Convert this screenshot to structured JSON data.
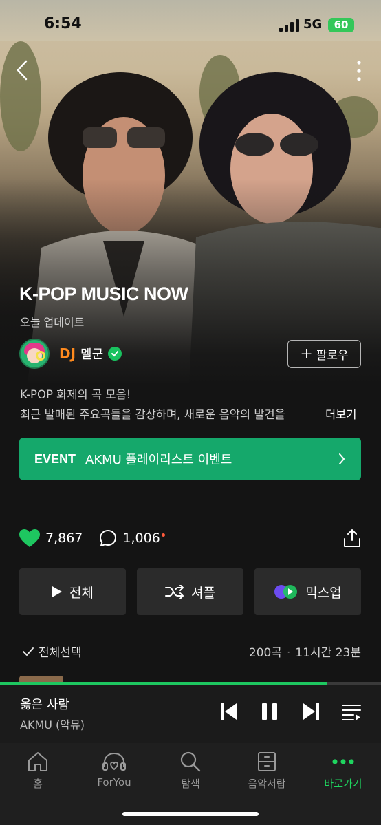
{
  "status_bar": {
    "time": "6:54",
    "network": "5G",
    "battery": "60"
  },
  "playlist": {
    "title": "K-POP MUSIC NOW",
    "subtitle": "오늘 업데이트",
    "dj_label": "DJ",
    "dj_name": "멜군",
    "follow_label": "팔로우",
    "description_line1": "K-POP 화제의 곡 모음!",
    "description_line2": "최근 발매된 주요곡들을 감상하며, 새로운 음악의 발견을",
    "more_label": "더보기"
  },
  "event": {
    "tag": "EVENT",
    "text": "AKMU 플레이리스트 이벤트"
  },
  "stats": {
    "likes": "7,867",
    "comments": "1,006"
  },
  "actions": {
    "play_all": "전체",
    "shuffle": "셔플",
    "mixup": "믹스업"
  },
  "list_header": {
    "select_all": "전체선택",
    "track_count": "200곡",
    "duration": "11시간 23분"
  },
  "now_playing": {
    "title": "옳은 사람",
    "artist": "AKMU (악뮤)",
    "progress": 0.86
  },
  "tabs": [
    {
      "label": "홈",
      "icon": "home-icon"
    },
    {
      "label": "ForYou",
      "icon": "headphones-heart-icon"
    },
    {
      "label": "탐색",
      "icon": "search-icon"
    },
    {
      "label": "음악서랍",
      "icon": "drawer-icon"
    },
    {
      "label": "바로가기",
      "icon": "more-dots-icon",
      "active": true
    }
  ],
  "colors": {
    "accent": "#1ec760",
    "event_bg": "#15a86b",
    "dj_label": "#ff8a1e",
    "background": "#141414"
  }
}
